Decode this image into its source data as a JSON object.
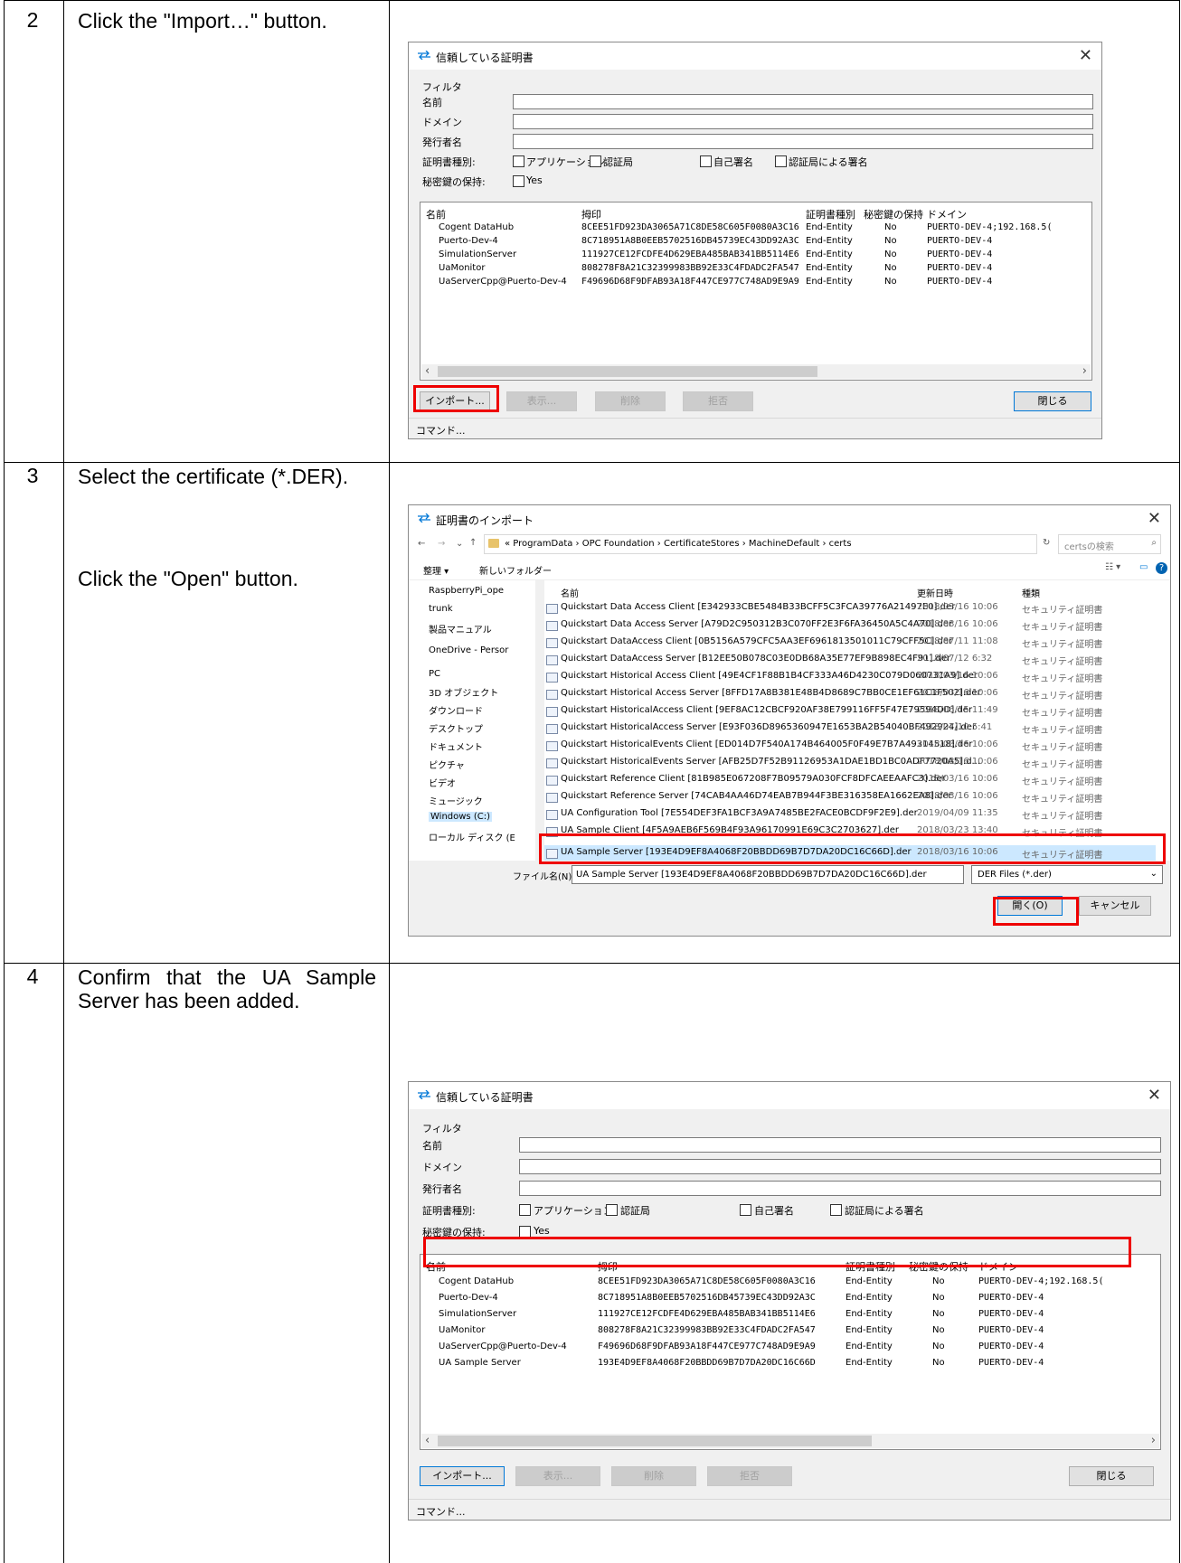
{
  "steps": [
    {
      "num": "2",
      "instruction": "Click the \"Import…\" button."
    },
    {
      "num": "3",
      "instruction_a": "Select the certificate (*.DER).",
      "instruction_b": "Click the \"Open\" button."
    },
    {
      "num": "4",
      "instruction": "Confirm that the UA Sample Server has been added."
    }
  ],
  "trusted_dialog": {
    "title": "信頼している証明書",
    "filter_group": "フィルタ",
    "filter_name": "名前",
    "filter_domain": "ドメイン",
    "filter_issuer": "発行者名",
    "filter_cert_type": "証明書種別:",
    "opt_application": "アプリケーション",
    "opt_ca": "認証局",
    "opt_self_signed": "自己署名",
    "opt_ca_signed": "認証局による署名",
    "filter_private_key": "秘密鍵の保持:",
    "opt_yes": "Yes",
    "col_name": "名前",
    "col_thumbprint": "拇印",
    "col_type": "証明書種別",
    "col_private_key": "秘密鍵の保持",
    "col_domain": "ドメイン",
    "rows": [
      {
        "name": "Cogent DataHub",
        "thumbprint": "8CEE51FD923DA3065A71C8DE58C605F0080A3C16",
        "type": "End-Entity",
        "key": "No",
        "domain": "PUERTO-DEV-4;192.168.5("
      },
      {
        "name": "Puerto-Dev-4",
        "thumbprint": "8C718951A8B0EEB5702516DB45739EC43DD92A3C",
        "type": "End-Entity",
        "key": "No",
        "domain": "PUERTO-DEV-4"
      },
      {
        "name": "SimulationServer",
        "thumbprint": "111927CE12FCDFE4D629EBA485BAB341BB5114E6",
        "type": "End-Entity",
        "key": "No",
        "domain": "PUERTO-DEV-4"
      },
      {
        "name": "UaMonitor",
        "thumbprint": "808278F8A21C32399983BB92E33C4FDADC2FA547",
        "type": "End-Entity",
        "key": "No",
        "domain": "PUERTO-DEV-4"
      },
      {
        "name": "UaServerCpp@Puerto-Dev-4",
        "thumbprint": "F49696D68F9DFAB93A18F447CE977C748AD9E9A9",
        "type": "End-Entity",
        "key": "No",
        "domain": "PUERTO-DEV-4"
      }
    ],
    "added_row": {
      "name": "UA Sample Server",
      "thumbprint": "193E4D9EF8A4068F20BBDD69B7D7DA20DC16C66D",
      "type": "End-Entity",
      "key": "No",
      "domain": "PUERTO-DEV-4"
    },
    "btn_import": "インポート...",
    "btn_view": "表示...",
    "btn_delete": "削除",
    "btn_reject": "拒否",
    "btn_close": "閉じる",
    "status": "コマンド..."
  },
  "import_dialog": {
    "title": "証明書のインポート",
    "breadcrumb": "«  ProgramData  ›  OPC Foundation  ›  CertificateStores  ›  MachineDefault  ›  certs",
    "search_placeholder": "certsの検索",
    "organize": "整理 ▾",
    "new_folder": "新しいフォルダー",
    "col_name": "名前",
    "col_date": "更新日時",
    "col_type": "種類",
    "sidebar": [
      "RaspberryPi_ope",
      "trunk",
      "製品マニュアル",
      "OneDrive - Persor",
      "PC",
      "3D オブジェクト",
      "ダウンロード",
      "デスクトップ",
      "ドキュメント",
      "ピクチャ",
      "ビデオ",
      "ミュージック",
      "Windows (C:)",
      "ローカル ディスク (E"
    ],
    "files": [
      {
        "name": "Quickstart Data Access Client [E342933CBE5484B33BCFF5C3FCA39776A21497E0].der",
        "date": "2018/03/16 10:06",
        "type": "セキュリティ証明書"
      },
      {
        "name": "Quickstart Data Access Server [A79D2C950312B3C070FF2E3F6FA36450A5C4A70].der",
        "date": "2018/03/16 10:06",
        "type": "セキュリティ証明書"
      },
      {
        "name": "Quickstart DataAccess Client [0B5156A579CFC5AA3EF6961813501011C79CFF5C].der",
        "date": "2018/07/11 11:08",
        "type": "セキュリティ証明書"
      },
      {
        "name": "Quickstart DataAccess Server [B12EE50B078C03E0DB68A35E77EF9B898EC4F91].der",
        "date": "2018/07/12 6:32",
        "type": "セキュリティ証明書"
      },
      {
        "name": "Quickstart Historical Access Client [49E4CF1F88B1B4CF333A46D4230C079D060731A9].der",
        "date": "2018/03/16 10:06",
        "type": "セキュリティ証明書"
      },
      {
        "name": "Quickstart Historical Access Server [8FFD17A8B381E48B4D8689C7BB0CE1EF61C1F502].der",
        "date": "2018/03/16 10:06",
        "type": "セキュリティ証明書"
      },
      {
        "name": "Quickstart HistoricalAccess Client [9EF8AC12CBCF920AF38E799116FF5F47E79594DD].der",
        "date": "2018/06/15 11:49",
        "type": "セキュリティ証明書"
      },
      {
        "name": "Quickstart HistoricalAccess Server [E93F036D8965360947E1653BA2B54040BF492924].der",
        "date": "2018/07/10 5:41",
        "type": "セキュリティ証明書"
      },
      {
        "name": "Quickstart HistoricalEvents Client [ED014D7F540A174B464005F0F49E7B7A49314518].der",
        "date": "2018/03/16 10:06",
        "type": "セキュリティ証明書"
      },
      {
        "name": "Quickstart HistoricalEvents Server [AFB25D7F52B91126953A1DAE1BD1BC0ADF7720A5].d...",
        "date": "2018/03/16 10:06",
        "type": "セキュリティ証明書"
      },
      {
        "name": "Quickstart Reference Client [81B985E067208F7B09579A030FCF8DFCAEEAAFC3].der",
        "date": "2018/03/16 10:06",
        "type": "セキュリティ証明書"
      },
      {
        "name": "Quickstart Reference Server [74CAB4AA46D74EAB7B944F3BE316358EA1662EA8].der",
        "date": "2018/03/16 10:06",
        "type": "セキュリティ証明書"
      },
      {
        "name": "UA Configuration Tool [7E554DEF3FA1BCF3A9A7485BE2FACE0BCDF9F2E9].der",
        "date": "2019/04/09 11:35",
        "type": "セキュリティ証明書"
      },
      {
        "name": "UA Sample Client [4F5A9AEB6F569B4F93A96170991E69C3C2703627].der",
        "date": "2018/03/23 13:40",
        "type": "セキュリティ証明書"
      }
    ],
    "selected_file": {
      "name": "UA Sample Server [193E4D9EF8A4068F20BBDD69B7D7DA20DC16C66D].der",
      "date": "2018/03/16 10:06",
      "type": "セキュリティ証明書"
    },
    "filename_label": "ファイル名(N):",
    "filename_value": "UA Sample Server [193E4D9EF8A4068F20BBDD69B7D7DA20DC16C66D].der",
    "filetype": "DER Files (*.der)",
    "btn_open": "開く(O)",
    "btn_cancel": "キャンセル"
  },
  "colors": {
    "highlight": "#e00000",
    "selection": "#cce8ff",
    "accent": "#0078d7"
  }
}
